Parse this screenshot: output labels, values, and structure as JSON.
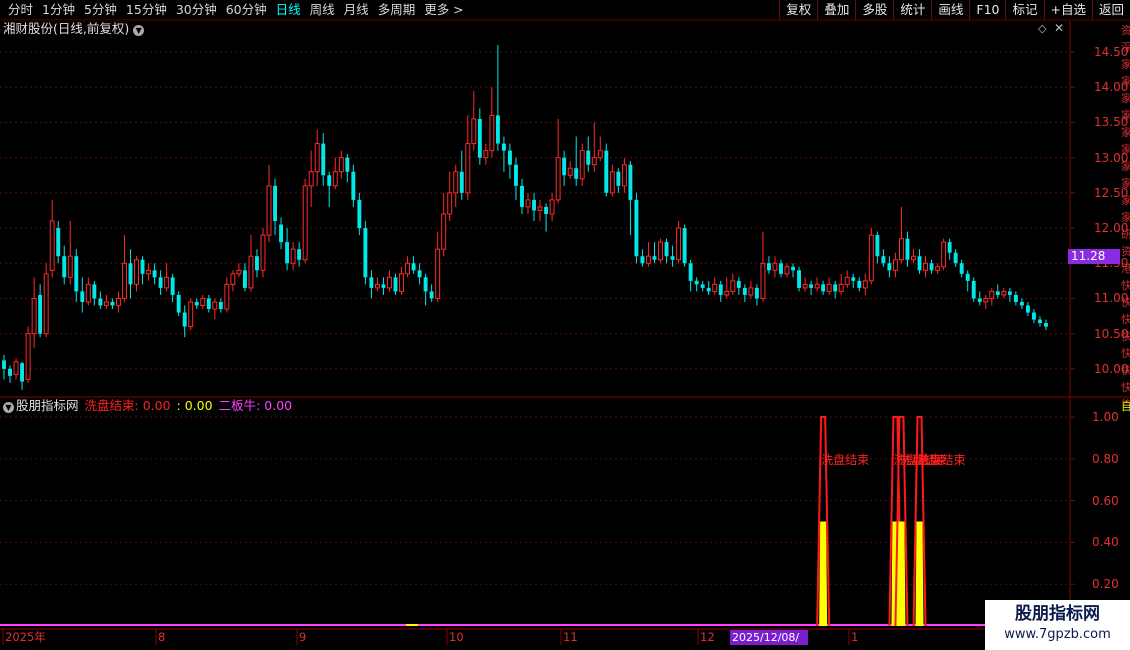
{
  "toolbar": {
    "periods": [
      "分时",
      "1分钟",
      "5分钟",
      "15分钟",
      "30分钟",
      "60分钟",
      "日线",
      "周线",
      "月线",
      "多周期",
      "更多 >"
    ],
    "active_period": "日线",
    "buttons": [
      "复权",
      "叠加",
      "多股",
      "统计",
      "画线",
      "F10",
      "标记",
      "+自选",
      "返回"
    ]
  },
  "main_chart": {
    "title": "湘财股份(日线,前复权)",
    "y_ticks": [
      "14.50",
      "14.00",
      "13.50",
      "13.00",
      "12.50",
      "12.00",
      "11.50",
      "11.00",
      "10.50",
      "10.00"
    ],
    "last_price": "11.28",
    "right_strip_text": "资深家家家家家家家家家家研资港快快快快快快快快"
  },
  "sub_chart": {
    "indicator_name": "股朋指标网",
    "value1": "洗盘结束: 0.00",
    "value2": ": 0.00",
    "value3": "二板牛: 0.00",
    "y_ticks": [
      "1.00",
      "0.80",
      "0.60",
      "0.40",
      "0.20"
    ],
    "annotation": "洗盘结束",
    "edge_label": "自"
  },
  "x_axis": {
    "labels": [
      "2025年",
      "8",
      "9",
      "10",
      "11",
      "12",
      "1"
    ],
    "cursor_date": "2025/12/08/—"
  },
  "watermark": {
    "title": "股朋指标网",
    "url": "www.7gpzb.com"
  },
  "colors": {
    "up": "#ff2a2a",
    "down": "#00e8e8",
    "axis": "#8a0000",
    "signal_fill": "#ffff00",
    "signal_line": "#ff1a1a"
  },
  "chart_data": {
    "type": "candlestick",
    "ylim": [
      9.6,
      14.7
    ],
    "candles": [
      [
        10.12,
        10.0,
        10.2,
        9.85
      ],
      [
        10.0,
        9.9,
        10.05,
        9.8
      ],
      [
        9.92,
        10.1,
        10.15,
        9.85
      ],
      [
        10.08,
        9.82,
        10.1,
        9.7
      ],
      [
        9.85,
        10.5,
        10.6,
        9.8
      ],
      [
        10.5,
        11.0,
        11.3,
        10.3
      ],
      [
        11.05,
        10.5,
        11.2,
        10.45
      ],
      [
        10.5,
        11.35,
        11.5,
        10.45
      ],
      [
        11.4,
        12.1,
        12.4,
        11.3
      ],
      [
        12.0,
        11.6,
        12.1,
        11.5
      ],
      [
        11.6,
        11.3,
        11.75,
        11.2
      ],
      [
        11.3,
        11.6,
        12.1,
        11.2
      ],
      [
        11.6,
        11.1,
        11.7,
        10.95
      ],
      [
        11.1,
        10.95,
        11.3,
        10.8
      ],
      [
        10.95,
        11.2,
        11.3,
        10.9
      ],
      [
        11.2,
        11.0,
        11.25,
        10.9
      ],
      [
        11.0,
        10.9,
        11.1,
        10.85
      ],
      [
        10.9,
        10.95,
        11.05,
        10.85
      ],
      [
        10.95,
        10.9,
        11.0,
        10.85
      ],
      [
        10.9,
        11.0,
        11.1,
        10.8
      ],
      [
        11.0,
        11.5,
        11.9,
        10.95
      ],
      [
        11.5,
        11.2,
        11.7,
        11.0
      ],
      [
        11.2,
        11.55,
        11.6,
        11.1
      ],
      [
        11.55,
        11.35,
        11.6,
        11.2
      ],
      [
        11.35,
        11.4,
        11.5,
        11.25
      ],
      [
        11.4,
        11.3,
        11.5,
        11.2
      ],
      [
        11.3,
        11.15,
        11.4,
        11.05
      ],
      [
        11.15,
        11.3,
        11.5,
        11.1
      ],
      [
        11.3,
        11.05,
        11.35,
        10.95
      ],
      [
        11.05,
        10.8,
        11.1,
        10.75
      ],
      [
        10.8,
        10.6,
        10.9,
        10.45
      ],
      [
        10.6,
        10.95,
        11.0,
        10.55
      ],
      [
        10.95,
        10.9,
        11.0,
        10.85
      ],
      [
        10.9,
        11.0,
        11.05,
        10.85
      ],
      [
        11.0,
        10.85,
        11.05,
        10.8
      ],
      [
        10.85,
        10.95,
        11.0,
        10.7
      ],
      [
        10.95,
        10.85,
        11.0,
        10.8
      ],
      [
        10.85,
        11.2,
        11.3,
        10.8
      ],
      [
        11.2,
        11.35,
        11.4,
        11.1
      ],
      [
        11.35,
        11.4,
        11.5,
        11.3
      ],
      [
        11.4,
        11.15,
        11.5,
        11.1
      ],
      [
        11.15,
        11.6,
        11.9,
        11.1
      ],
      [
        11.6,
        11.4,
        11.7,
        11.3
      ],
      [
        11.4,
        11.9,
        12.0,
        11.3
      ],
      [
        11.9,
        12.6,
        12.9,
        11.8
      ],
      [
        12.6,
        12.1,
        12.7,
        11.9
      ],
      [
        12.05,
        11.8,
        12.15,
        11.7
      ],
      [
        11.8,
        11.5,
        12.0,
        11.4
      ],
      [
        11.5,
        11.7,
        11.8,
        11.4
      ],
      [
        11.7,
        11.55,
        11.8,
        11.45
      ],
      [
        11.55,
        12.6,
        12.7,
        11.5
      ],
      [
        12.6,
        12.8,
        13.1,
        12.3
      ],
      [
        12.8,
        13.2,
        13.4,
        12.6
      ],
      [
        13.2,
        12.75,
        13.35,
        12.6
      ],
      [
        12.75,
        12.6,
        12.8,
        12.3
      ],
      [
        12.6,
        12.8,
        13.0,
        12.55
      ],
      [
        12.8,
        13.0,
        13.1,
        12.7
      ],
      [
        13.0,
        12.8,
        13.05,
        12.65
      ],
      [
        12.8,
        12.4,
        12.9,
        12.3
      ],
      [
        12.4,
        12.0,
        12.5,
        11.9
      ],
      [
        12.0,
        11.3,
        12.1,
        11.2
      ],
      [
        11.3,
        11.15,
        11.4,
        11.0
      ],
      [
        11.15,
        11.2,
        11.3,
        11.1
      ],
      [
        11.2,
        11.15,
        11.3,
        11.05
      ],
      [
        11.15,
        11.3,
        11.4,
        11.1
      ],
      [
        11.3,
        11.1,
        11.35,
        11.05
      ],
      [
        11.1,
        11.35,
        11.45,
        11.05
      ],
      [
        11.35,
        11.5,
        11.6,
        11.3
      ],
      [
        11.5,
        11.4,
        11.6,
        11.35
      ],
      [
        11.4,
        11.3,
        11.5,
        11.2
      ],
      [
        11.3,
        11.1,
        11.35,
        10.9
      ],
      [
        11.1,
        11.0,
        11.2,
        10.95
      ],
      [
        11.0,
        11.7,
        11.95,
        10.95
      ],
      [
        11.7,
        12.2,
        12.5,
        11.6
      ],
      [
        12.2,
        12.5,
        12.8,
        12.1
      ],
      [
        12.5,
        12.8,
        12.9,
        12.3
      ],
      [
        12.8,
        12.5,
        13.1,
        12.4
      ],
      [
        12.5,
        13.2,
        13.6,
        12.4
      ],
      [
        13.2,
        13.55,
        13.95,
        13.1
      ],
      [
        13.55,
        13.0,
        13.7,
        12.9
      ],
      [
        13.0,
        13.1,
        13.2,
        12.9
      ],
      [
        13.1,
        13.6,
        14.0,
        13.0
      ],
      [
        13.6,
        13.2,
        14.6,
        13.1
      ],
      [
        13.2,
        13.1,
        13.3,
        12.8
      ],
      [
        13.1,
        12.9,
        13.2,
        12.7
      ],
      [
        12.9,
        12.6,
        13.0,
        12.4
      ],
      [
        12.6,
        12.3,
        12.7,
        12.2
      ],
      [
        12.3,
        12.4,
        12.5,
        12.2
      ],
      [
        12.4,
        12.25,
        12.5,
        12.1
      ],
      [
        12.25,
        12.3,
        12.4,
        12.1
      ],
      [
        12.3,
        12.2,
        12.35,
        11.95
      ],
      [
        12.2,
        12.4,
        12.5,
        12.1
      ],
      [
        12.4,
        13.0,
        13.55,
        12.35
      ],
      [
        13.0,
        12.75,
        13.1,
        12.6
      ],
      [
        12.75,
        12.85,
        12.95,
        12.7
      ],
      [
        12.85,
        12.7,
        13.3,
        12.6
      ],
      [
        12.7,
        13.1,
        13.2,
        12.6
      ],
      [
        13.1,
        12.9,
        13.3,
        12.8
      ],
      [
        12.9,
        13.0,
        13.5,
        12.8
      ],
      [
        13.0,
        13.1,
        13.3,
        12.95
      ],
      [
        13.1,
        12.5,
        13.2,
        12.45
      ],
      [
        12.5,
        12.8,
        12.9,
        12.45
      ],
      [
        12.8,
        12.6,
        12.85,
        12.5
      ],
      [
        12.6,
        12.9,
        13.0,
        12.5
      ],
      [
        12.9,
        12.4,
        12.95,
        11.9
      ],
      [
        12.4,
        11.6,
        12.5,
        11.5
      ],
      [
        11.6,
        11.5,
        11.7,
        11.45
      ],
      [
        11.5,
        11.6,
        11.8,
        11.45
      ],
      [
        11.6,
        11.55,
        11.8,
        11.5
      ],
      [
        11.55,
        11.8,
        11.85,
        11.5
      ],
      [
        11.8,
        11.6,
        11.85,
        11.5
      ],
      [
        11.6,
        11.55,
        11.75,
        11.45
      ],
      [
        11.55,
        12.0,
        12.1,
        11.5
      ],
      [
        12.0,
        11.5,
        12.05,
        11.45
      ],
      [
        11.5,
        11.25,
        11.55,
        11.1
      ],
      [
        11.25,
        11.2,
        11.3,
        11.1
      ],
      [
        11.2,
        11.15,
        11.25,
        11.1
      ],
      [
        11.15,
        11.1,
        11.25,
        11.05
      ],
      [
        11.1,
        11.2,
        11.3,
        11.05
      ],
      [
        11.2,
        11.05,
        11.25,
        10.95
      ],
      [
        11.05,
        11.1,
        11.3,
        11.0
      ],
      [
        11.1,
        11.25,
        11.35,
        11.05
      ],
      [
        11.25,
        11.15,
        11.3,
        11.05
      ],
      [
        11.15,
        11.05,
        11.2,
        10.95
      ],
      [
        11.05,
        11.15,
        11.25,
        11.0
      ],
      [
        11.15,
        11.0,
        11.2,
        10.9
      ],
      [
        11.0,
        11.5,
        11.95,
        10.95
      ],
      [
        11.5,
        11.4,
        11.6,
        11.35
      ],
      [
        11.4,
        11.5,
        11.6,
        11.3
      ],
      [
        11.5,
        11.35,
        11.55,
        11.3
      ],
      [
        11.35,
        11.45,
        11.5,
        11.3
      ],
      [
        11.45,
        11.4,
        11.5,
        11.3
      ],
      [
        11.4,
        11.15,
        11.45,
        11.1
      ],
      [
        11.15,
        11.2,
        11.3,
        11.1
      ],
      [
        11.2,
        11.15,
        11.25,
        11.05
      ],
      [
        11.15,
        11.2,
        11.3,
        11.1
      ],
      [
        11.2,
        11.1,
        11.25,
        11.05
      ],
      [
        11.1,
        11.2,
        11.3,
        11.05
      ],
      [
        11.2,
        11.1,
        11.25,
        11.0
      ],
      [
        11.1,
        11.2,
        11.35,
        11.05
      ],
      [
        11.2,
        11.3,
        11.4,
        11.15
      ],
      [
        11.3,
        11.25,
        11.35,
        11.15
      ],
      [
        11.25,
        11.15,
        11.3,
        11.1
      ],
      [
        11.15,
        11.25,
        11.35,
        11.05
      ],
      [
        11.25,
        11.9,
        12.0,
        11.2
      ],
      [
        11.9,
        11.6,
        11.95,
        11.5
      ],
      [
        11.6,
        11.5,
        11.7,
        11.45
      ],
      [
        11.5,
        11.4,
        11.6,
        11.3
      ],
      [
        11.4,
        11.55,
        11.65,
        11.3
      ],
      [
        11.55,
        11.85,
        12.3,
        11.5
      ],
      [
        11.85,
        11.55,
        11.95,
        11.45
      ],
      [
        11.55,
        11.6,
        11.7,
        11.5
      ],
      [
        11.6,
        11.4,
        11.7,
        11.35
      ],
      [
        11.4,
        11.5,
        11.6,
        11.3
      ],
      [
        11.5,
        11.4,
        11.55,
        11.35
      ],
      [
        11.4,
        11.45,
        11.5,
        11.35
      ],
      [
        11.45,
        11.8,
        11.85,
        11.4
      ],
      [
        11.8,
        11.65,
        11.85,
        11.55
      ],
      [
        11.65,
        11.5,
        11.7,
        11.45
      ],
      [
        11.5,
        11.35,
        11.55,
        11.3
      ],
      [
        11.35,
        11.25,
        11.4,
        11.1
      ],
      [
        11.25,
        11.0,
        11.3,
        10.95
      ],
      [
        11.0,
        10.95,
        11.1,
        10.9
      ],
      [
        10.95,
        11.0,
        11.05,
        10.85
      ],
      [
        11.0,
        11.1,
        11.15,
        10.9
      ],
      [
        11.1,
        11.05,
        11.2,
        11.0
      ],
      [
        11.05,
        11.1,
        11.15,
        11.0
      ],
      [
        11.1,
        11.05,
        11.15,
        10.95
      ],
      [
        11.05,
        10.95,
        11.1,
        10.9
      ],
      [
        10.95,
        10.9,
        11.0,
        10.85
      ],
      [
        10.9,
        10.8,
        10.95,
        10.75
      ],
      [
        10.8,
        10.7,
        10.85,
        10.65
      ],
      [
        10.7,
        10.65,
        10.75,
        10.6
      ],
      [
        10.65,
        10.6,
        10.7,
        10.55
      ]
    ],
    "signal": {
      "ylim": [
        0,
        1.0
      ],
      "events": [
        {
          "bar": 136,
          "peak": 1.0,
          "base": 0.5
        },
        {
          "bar": 148,
          "peak": 1.0,
          "base": 0.5
        },
        {
          "bar": 149,
          "peak": 1.0,
          "base": 0.5
        },
        {
          "bar": 152,
          "peak": 1.0,
          "base": 0.5
        }
      ]
    }
  }
}
